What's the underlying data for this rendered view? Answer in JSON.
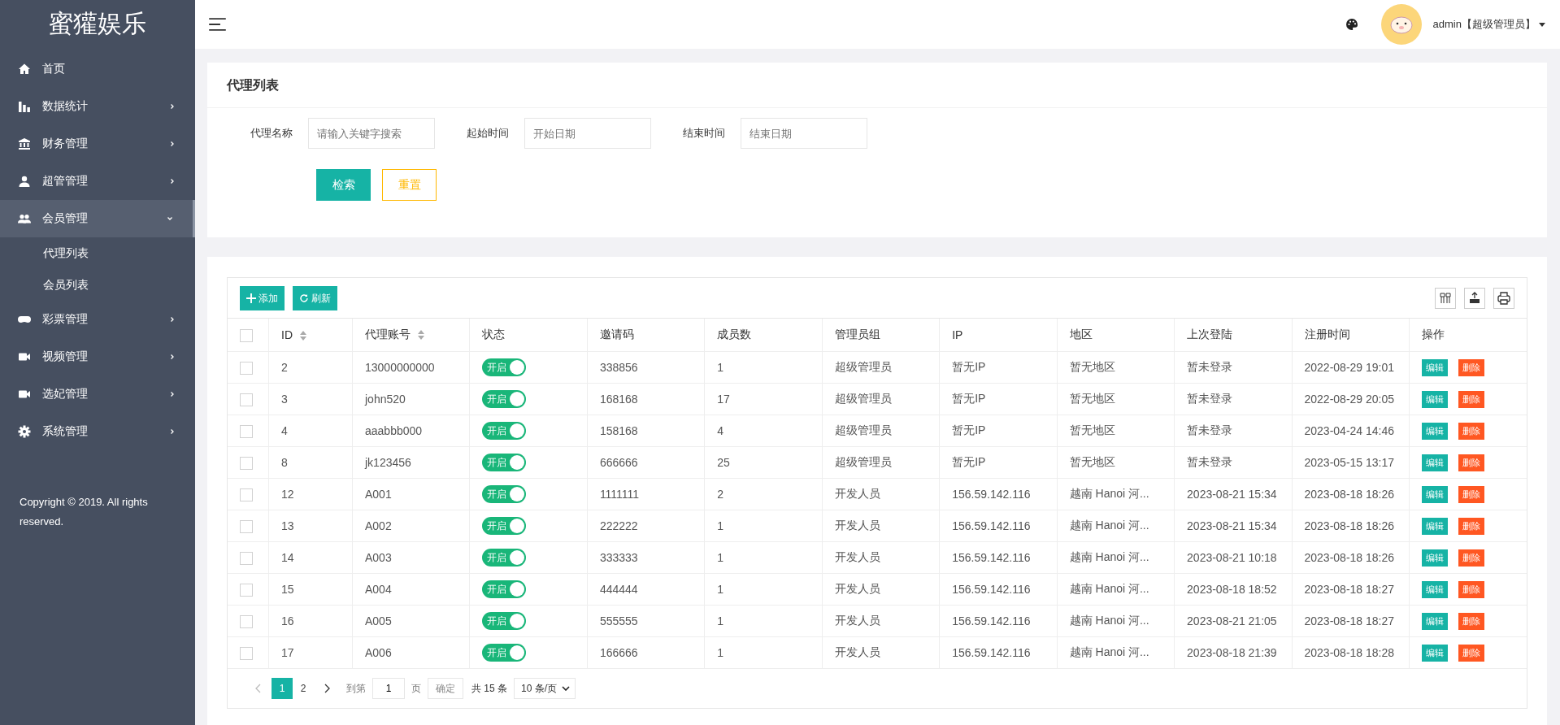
{
  "sidebar": {
    "logo": "蜜獾娱乐",
    "items": [
      {
        "label": "首页"
      },
      {
        "label": "数据统计",
        "expanded": false
      },
      {
        "label": "财务管理",
        "expanded": false
      },
      {
        "label": "超管管理",
        "expanded": false
      },
      {
        "label": "会员管理",
        "expanded": true,
        "children": [
          {
            "label": "代理列表"
          },
          {
            "label": "会员列表"
          }
        ]
      },
      {
        "label": "彩票管理",
        "expanded": false
      },
      {
        "label": "视频管理",
        "expanded": false
      },
      {
        "label": "选妃管理",
        "expanded": false
      },
      {
        "label": "系统管理",
        "expanded": false
      }
    ],
    "copyright": "Copyright © 2019. All rights reserved."
  },
  "header": {
    "user": "admin【超级管理员】"
  },
  "search_panel": {
    "title": "代理列表",
    "fields": [
      {
        "label": "代理名称",
        "placeholder": "请输入关键字搜索"
      },
      {
        "label": "起始时间",
        "placeholder": "开始日期"
      },
      {
        "label": "结束时间",
        "placeholder": "结束日期"
      }
    ],
    "buttons": [
      "检索",
      "重置"
    ]
  },
  "table": {
    "toolbar": [
      "添加",
      "刷新"
    ],
    "header_checked": false,
    "columns": [
      {
        "label": "ID",
        "sortable": true
      },
      {
        "label": "代理账号",
        "sortable": true
      },
      {
        "label": "状态",
        "sortable": false
      },
      {
        "label": "邀请码",
        "sortable": false
      },
      {
        "label": "成员数",
        "sortable": false
      },
      {
        "label": "管理员组",
        "sortable": false
      },
      {
        "label": "IP",
        "sortable": false
      },
      {
        "label": "地区",
        "sortable": false
      },
      {
        "label": "上次登陆",
        "sortable": false
      },
      {
        "label": "注册时间",
        "sortable": false
      },
      {
        "label": "操作",
        "sortable": false
      }
    ],
    "rows": [
      {
        "checked": false,
        "id": "2",
        "account": "13000000000",
        "on": true,
        "status": "开启",
        "invite": "338856",
        "members": "1",
        "group": "超级管理员",
        "ip": "暂无IP",
        "region": "暂无地区",
        "last_login": "暂未登录",
        "registered": "2022-08-29 19:01",
        "actions": [
          "编辑",
          "删除"
        ]
      },
      {
        "checked": false,
        "id": "3",
        "account": "john520",
        "on": true,
        "status": "开启",
        "invite": "168168",
        "members": "17",
        "group": "超级管理员",
        "ip": "暂无IP",
        "region": "暂无地区",
        "last_login": "暂未登录",
        "registered": "2022-08-29 20:05",
        "actions": [
          "编辑",
          "删除"
        ]
      },
      {
        "checked": false,
        "id": "4",
        "account": "aaabbb000",
        "on": true,
        "status": "开启",
        "invite": "158168",
        "members": "4",
        "group": "超级管理员",
        "ip": "暂无IP",
        "region": "暂无地区",
        "last_login": "暂未登录",
        "registered": "2023-04-24 14:46",
        "actions": [
          "编辑",
          "删除"
        ]
      },
      {
        "checked": false,
        "id": "8",
        "account": "jk123456",
        "on": true,
        "status": "开启",
        "invite": "666666",
        "members": "25",
        "group": "超级管理员",
        "ip": "暂无IP",
        "region": "暂无地区",
        "last_login": "暂未登录",
        "registered": "2023-05-15 13:17",
        "actions": [
          "编辑",
          "删除"
        ]
      },
      {
        "checked": false,
        "id": "12",
        "account": "A001",
        "on": true,
        "status": "开启",
        "invite": "1111111",
        "members": "2",
        "group": "开发人员",
        "ip": "156.59.142.116",
        "region": "越南 Hanoi 河...",
        "last_login": "2023-08-21 15:34",
        "registered": "2023-08-18 18:26",
        "actions": [
          "编辑",
          "删除"
        ]
      },
      {
        "checked": false,
        "id": "13",
        "account": "A002",
        "on": true,
        "status": "开启",
        "invite": "222222",
        "members": "1",
        "group": "开发人员",
        "ip": "156.59.142.116",
        "region": "越南 Hanoi 河...",
        "last_login": "2023-08-21 15:34",
        "registered": "2023-08-18 18:26",
        "actions": [
          "编辑",
          "删除"
        ]
      },
      {
        "checked": false,
        "id": "14",
        "account": "A003",
        "on": true,
        "status": "开启",
        "invite": "333333",
        "members": "1",
        "group": "开发人员",
        "ip": "156.59.142.116",
        "region": "越南 Hanoi 河...",
        "last_login": "2023-08-21 10:18",
        "registered": "2023-08-18 18:26",
        "actions": [
          "编辑",
          "删除"
        ]
      },
      {
        "checked": false,
        "id": "15",
        "account": "A004",
        "on": true,
        "status": "开启",
        "invite": "444444",
        "members": "1",
        "group": "开发人员",
        "ip": "156.59.142.116",
        "region": "越南 Hanoi 河...",
        "last_login": "2023-08-18 18:52",
        "registered": "2023-08-18 18:27",
        "actions": [
          "编辑",
          "删除"
        ]
      },
      {
        "checked": false,
        "id": "16",
        "account": "A005",
        "on": true,
        "status": "开启",
        "invite": "555555",
        "members": "1",
        "group": "开发人员",
        "ip": "156.59.142.116",
        "region": "越南 Hanoi 河...",
        "last_login": "2023-08-21 21:05",
        "registered": "2023-08-18 18:27",
        "actions": [
          "编辑",
          "删除"
        ]
      },
      {
        "checked": false,
        "id": "17",
        "account": "A006",
        "on": true,
        "status": "开启",
        "invite": "166666",
        "members": "1",
        "group": "开发人员",
        "ip": "156.59.142.116",
        "region": "越南 Hanoi 河...",
        "last_login": "2023-08-18 21:39",
        "registered": "2023-08-18 18:28",
        "actions": [
          "编辑",
          "删除"
        ]
      }
    ]
  },
  "pagination": {
    "pages": [
      {
        "label": "1",
        "selected": true
      },
      {
        "label": "2",
        "selected": false
      }
    ],
    "goto_label": "到第",
    "goto_value": "1",
    "page_unit": "页",
    "confirm": "确定",
    "total": "共 15 条",
    "page_size": "10 条/页"
  }
}
